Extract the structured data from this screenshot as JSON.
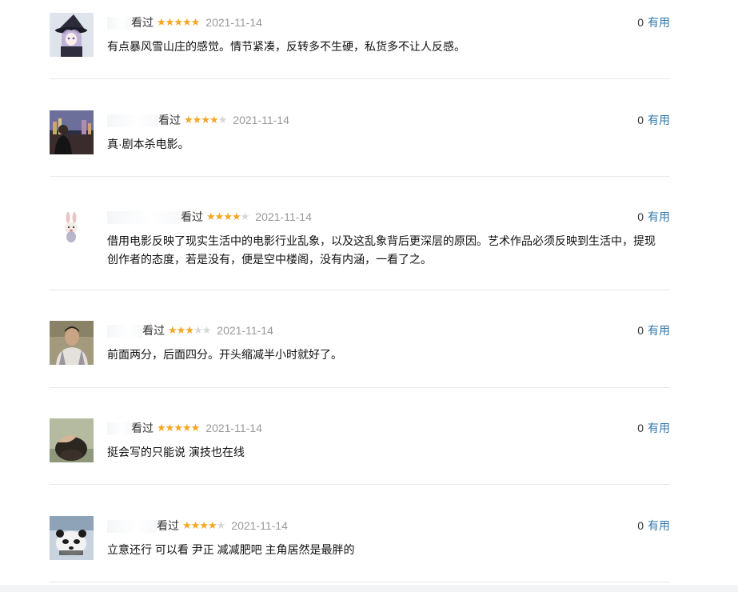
{
  "reviews": [
    {
      "watched": "看过",
      "rating": 5,
      "date": "2021-11-14",
      "votes": "0",
      "vote_label": "有用",
      "content": "有点暴风雪山庄的感觉。情节紧凑，反转多不生硬，私货多不让人反感。",
      "avatar_icon": "avatar-witch-anime-icon"
    },
    {
      "watched": "看过",
      "rating": 4,
      "date": "2021-11-14",
      "votes": "0",
      "vote_label": "有用",
      "content": "真·剧本杀电影。",
      "avatar_icon": "avatar-night-city-icon"
    },
    {
      "watched": "看过",
      "rating": 4,
      "date": "2021-11-14",
      "votes": "0",
      "vote_label": "有用",
      "content": "借用电影反映了现实生活中的电影行业乱象，以及这乱象背后更深层的原因。艺术作品必须反映到生活中，提现创作者的态度，若是没有，便是空中楼阁，没有内涵，一看了之。",
      "avatar_icon": "avatar-rabbit-icon"
    },
    {
      "watched": "看过",
      "rating": 3,
      "date": "2021-11-14",
      "votes": "0",
      "vote_label": "有用",
      "content": "前面两分，后面四分。开头缩减半小时就好了。",
      "avatar_icon": "avatar-man-portrait-icon"
    },
    {
      "watched": "看过",
      "rating": 5,
      "date": "2021-11-14",
      "votes": "0",
      "vote_label": "有用",
      "content": "挺会写的只能说 演技也在线",
      "avatar_icon": "avatar-head-hand-icon"
    },
    {
      "watched": "看过",
      "rating": 4,
      "date": "2021-11-14",
      "votes": "0",
      "vote_label": "有用",
      "content": "立意还行 可以看 尹正 减减肥吧 主角居然是最胖的",
      "avatar_icon": "avatar-panda-icon"
    }
  ],
  "colors": {
    "star_on": "#f5a623",
    "star_off": "#d6d6d6",
    "link": "#3377aa",
    "date": "#999999",
    "divider": "#e8e8e8"
  }
}
